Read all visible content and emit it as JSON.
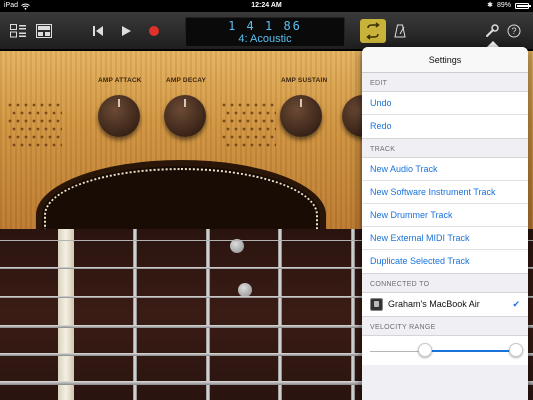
{
  "status_bar": {
    "device": "iPad",
    "time": "12:24 AM",
    "battery": "89%",
    "battery_level": 0.89
  },
  "toolbar": {
    "lcd_position": "1  4  1    86",
    "lcd_track": "4: Acoustic"
  },
  "amp": {
    "knobs": [
      {
        "label": "AMP ATTACK"
      },
      {
        "label": "AMP DECAY"
      },
      {
        "label": "AMP SUSTAIN"
      }
    ]
  },
  "settings": {
    "title": "Settings",
    "edit_header": "EDIT",
    "edit_items": [
      "Undo",
      "Redo"
    ],
    "track_header": "TRACK",
    "track_items": [
      "New Audio Track",
      "New Software Instrument Track",
      "New Drummer Track",
      "New External MIDI Track",
      "Duplicate Selected Track"
    ],
    "connected_header": "CONNECTED TO",
    "connected_device": "Graham's MacBook Air",
    "connected_checked": true,
    "velocity_header": "VELOCITY RANGE",
    "velocity_range": {
      "low": 0.38,
      "high": 1.0
    }
  },
  "colors": {
    "accent": "#1a73d9",
    "lcd_text": "#5bc0f0",
    "loop_active": "#c8b23a",
    "record": "#e0302a"
  }
}
